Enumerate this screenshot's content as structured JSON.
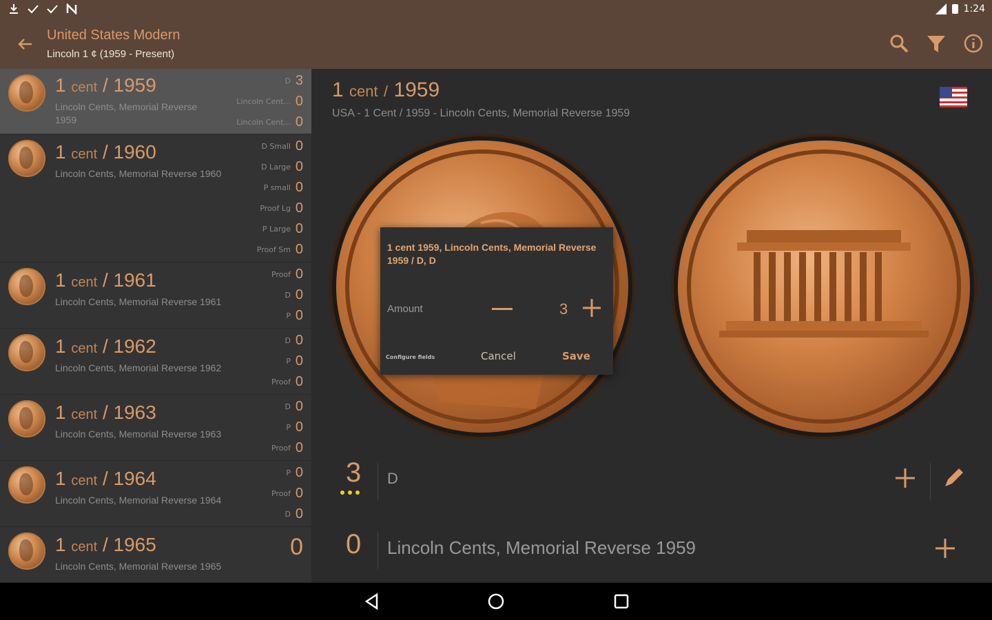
{
  "status": {
    "time": "1:24"
  },
  "appbar": {
    "title": "United States Modern",
    "subtitle": "Lincoln 1 ¢ (1959 - Present)"
  },
  "list": [
    {
      "value": "1",
      "unit": "cent",
      "year": "1959",
      "desc": "Lincoln Cents, Memorial Reverse 1959",
      "stats": [
        {
          "label": "D",
          "count": "3"
        },
        {
          "label": "Lincoln Cent...",
          "count": "0"
        },
        {
          "label": "Lincoln Cent...",
          "count": "0"
        }
      ]
    },
    {
      "value": "1",
      "unit": "cent",
      "year": "1960",
      "desc": "Lincoln Cents, Memorial Reverse 1960",
      "stats": [
        {
          "label": "D Small",
          "count": "0"
        },
        {
          "label": "D Large",
          "count": "0"
        },
        {
          "label": "P small",
          "count": "0"
        },
        {
          "label": "Proof Lg",
          "count": "0"
        },
        {
          "label": "P Large",
          "count": "0"
        },
        {
          "label": "Proof Sm",
          "count": "0"
        }
      ]
    },
    {
      "value": "1",
      "unit": "cent",
      "year": "1961",
      "desc": "Lincoln Cents, Memorial Reverse 1961",
      "stats": [
        {
          "label": "Proof",
          "count": "0"
        },
        {
          "label": "D",
          "count": "0"
        },
        {
          "label": "P",
          "count": "0"
        }
      ]
    },
    {
      "value": "1",
      "unit": "cent",
      "year": "1962",
      "desc": "Lincoln Cents, Memorial Reverse 1962",
      "stats": [
        {
          "label": "D",
          "count": "0"
        },
        {
          "label": "P",
          "count": "0"
        },
        {
          "label": "Proof",
          "count": "0"
        }
      ]
    },
    {
      "value": "1",
      "unit": "cent",
      "year": "1963",
      "desc": "Lincoln Cents, Memorial Reverse 1963",
      "stats": [
        {
          "label": "D",
          "count": "0"
        },
        {
          "label": "P",
          "count": "0"
        },
        {
          "label": "Proof",
          "count": "0"
        }
      ]
    },
    {
      "value": "1",
      "unit": "cent",
      "year": "1964",
      "desc": "Lincoln Cents, Memorial Reverse 1964",
      "stats": [
        {
          "label": "P",
          "count": "0"
        },
        {
          "label": "Proof",
          "count": "0"
        },
        {
          "label": "D",
          "count": "0"
        }
      ]
    },
    {
      "value": "1",
      "unit": "cent",
      "year": "1965",
      "desc": "Lincoln Cents, Memorial Reverse 1965",
      "total": "0"
    }
  ],
  "detail": {
    "value": "1",
    "unit": "cent",
    "sep": "/",
    "year": "1959",
    "subtitle": "USA - 1 Cent / 1959 - Lincoln Cents, Memorial Reverse 1959",
    "variants": [
      {
        "count": "3",
        "label": "D"
      },
      {
        "count": "0",
        "label": "Lincoln Cents, Memorial Reverse 1959"
      }
    ]
  },
  "dialog": {
    "text": "1 cent 1959, Lincoln Cents, Memorial Reverse 1959 / D, D",
    "amount_label": "Amount",
    "amount_value": "3",
    "config_label": "Configure fields",
    "cancel_label": "Cancel",
    "save_label": "Save"
  },
  "colors": {
    "appbar": "#5a4538",
    "accent": "#d99a68",
    "background": "#2b2b2b"
  }
}
